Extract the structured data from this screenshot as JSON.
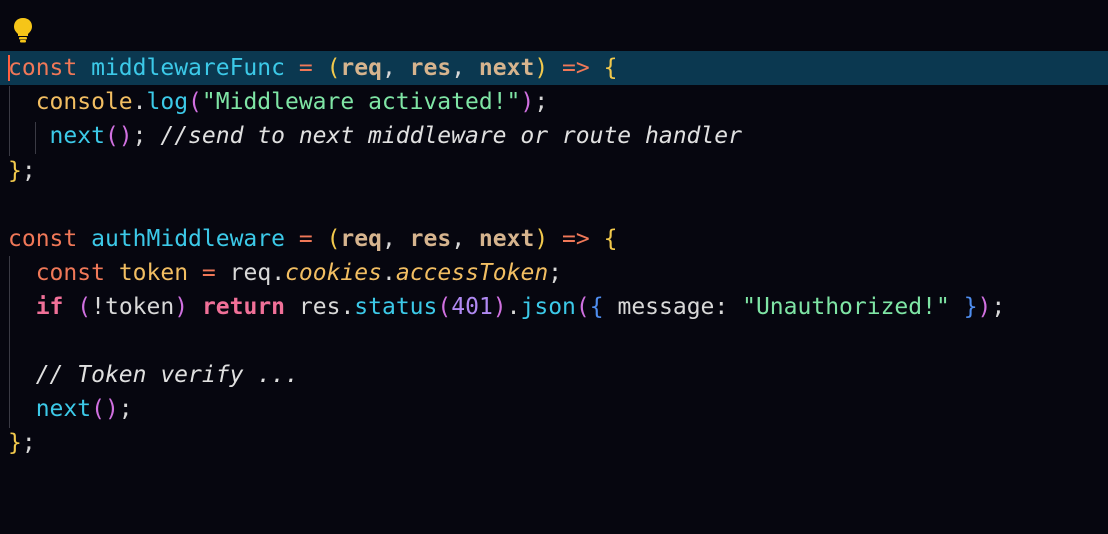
{
  "editor": {
    "lines": [
      {
        "tokens": [
          {
            "t": "const",
            "c": "kw"
          },
          {
            "t": " ",
            "c": "plain"
          },
          {
            "t": "middlewareFunc",
            "c": "ident"
          },
          {
            "t": " ",
            "c": "plain"
          },
          {
            "t": "=",
            "c": "op"
          },
          {
            "t": " ",
            "c": "plain"
          },
          {
            "t": "(",
            "c": "p1"
          },
          {
            "t": "req",
            "c": "param"
          },
          {
            "t": ", ",
            "c": "plain"
          },
          {
            "t": "res",
            "c": "param"
          },
          {
            "t": ", ",
            "c": "plain"
          },
          {
            "t": "next",
            "c": "param"
          },
          {
            "t": ")",
            "c": "p1"
          },
          {
            "t": " ",
            "c": "plain"
          },
          {
            "t": "=>",
            "c": "op"
          },
          {
            "t": " ",
            "c": "plain"
          },
          {
            "t": "{",
            "c": "p1"
          }
        ]
      },
      {
        "tokens": [
          {
            "t": "  ",
            "c": "plain"
          },
          {
            "t": "console",
            "c": "obj"
          },
          {
            "t": ".",
            "c": "plain"
          },
          {
            "t": "log",
            "c": "fn"
          },
          {
            "t": "(",
            "c": "p2"
          },
          {
            "t": "\"Middleware activated!\"",
            "c": "str"
          },
          {
            "t": ")",
            "c": "p2"
          },
          {
            "t": ";",
            "c": "plain"
          }
        ]
      },
      {
        "tokens": [
          {
            "t": "   ",
            "c": "plain"
          },
          {
            "t": "next",
            "c": "fn"
          },
          {
            "t": "()",
            "c": "p2"
          },
          {
            "t": "; ",
            "c": "plain"
          },
          {
            "t": "//send to next middleware or route handler",
            "c": "cmt"
          }
        ]
      },
      {
        "tokens": [
          {
            "t": "}",
            "c": "p1"
          },
          {
            "t": ";",
            "c": "plain"
          }
        ]
      },
      {
        "tokens": []
      },
      {
        "tokens": [
          {
            "t": "const",
            "c": "kw"
          },
          {
            "t": " ",
            "c": "plain"
          },
          {
            "t": "authMiddleware",
            "c": "ident"
          },
          {
            "t": " ",
            "c": "plain"
          },
          {
            "t": "=",
            "c": "op"
          },
          {
            "t": " ",
            "c": "plain"
          },
          {
            "t": "(",
            "c": "p1"
          },
          {
            "t": "req",
            "c": "param"
          },
          {
            "t": ", ",
            "c": "plain"
          },
          {
            "t": "res",
            "c": "param"
          },
          {
            "t": ", ",
            "c": "plain"
          },
          {
            "t": "next",
            "c": "param"
          },
          {
            "t": ")",
            "c": "p1"
          },
          {
            "t": " ",
            "c": "plain"
          },
          {
            "t": "=>",
            "c": "op"
          },
          {
            "t": " ",
            "c": "plain"
          },
          {
            "t": "{",
            "c": "p1"
          }
        ]
      },
      {
        "tokens": [
          {
            "t": "  ",
            "c": "plain"
          },
          {
            "t": "const",
            "c": "kw"
          },
          {
            "t": " ",
            "c": "plain"
          },
          {
            "t": "token",
            "c": "obj"
          },
          {
            "t": " ",
            "c": "plain"
          },
          {
            "t": "=",
            "c": "op"
          },
          {
            "t": " ",
            "c": "plain"
          },
          {
            "t": "req",
            "c": "plain"
          },
          {
            "t": ".",
            "c": "plain"
          },
          {
            "t": "cookies",
            "c": "prop"
          },
          {
            "t": ".",
            "c": "plain"
          },
          {
            "t": "accessToken",
            "c": "prop"
          },
          {
            "t": ";",
            "c": "plain"
          }
        ]
      },
      {
        "tokens": [
          {
            "t": "  ",
            "c": "plain"
          },
          {
            "t": "if",
            "c": "iff"
          },
          {
            "t": " ",
            "c": "plain"
          },
          {
            "t": "(",
            "c": "p2"
          },
          {
            "t": "!token",
            "c": "plain"
          },
          {
            "t": ")",
            "c": "p2"
          },
          {
            "t": " ",
            "c": "plain"
          },
          {
            "t": "return",
            "c": "ret"
          },
          {
            "t": " ",
            "c": "plain"
          },
          {
            "t": "res",
            "c": "plain"
          },
          {
            "t": ".",
            "c": "plain"
          },
          {
            "t": "status",
            "c": "fn"
          },
          {
            "t": "(",
            "c": "p2"
          },
          {
            "t": "401",
            "c": "num"
          },
          {
            "t": ")",
            "c": "p2"
          },
          {
            "t": ".",
            "c": "plain"
          },
          {
            "t": "json",
            "c": "fn"
          },
          {
            "t": "(",
            "c": "p2"
          },
          {
            "t": "{",
            "c": "p3"
          },
          {
            "t": " message: ",
            "c": "plain"
          },
          {
            "t": "\"Unauthorized!\"",
            "c": "str"
          },
          {
            "t": " ",
            "c": "plain"
          },
          {
            "t": "}",
            "c": "p3"
          },
          {
            "t": ")",
            "c": "p2"
          },
          {
            "t": ";",
            "c": "plain"
          }
        ]
      },
      {
        "tokens": []
      },
      {
        "tokens": [
          {
            "t": "  ",
            "c": "plain"
          },
          {
            "t": "// Token verify ...",
            "c": "cmt"
          }
        ]
      },
      {
        "tokens": [
          {
            "t": "  ",
            "c": "plain"
          },
          {
            "t": "next",
            "c": "fn"
          },
          {
            "t": "()",
            "c": "p2"
          },
          {
            "t": ";",
            "c": "plain"
          }
        ]
      },
      {
        "tokens": [
          {
            "t": "}",
            "c": "p1"
          },
          {
            "t": ";",
            "c": "plain"
          }
        ]
      }
    ]
  },
  "icons": {
    "lightbulb": "lightbulb-icon"
  },
  "colors": {
    "background": "#06060f",
    "active_line": "#0b3850",
    "cursor": "#ff6040",
    "lightbulb": "#f5c518"
  }
}
